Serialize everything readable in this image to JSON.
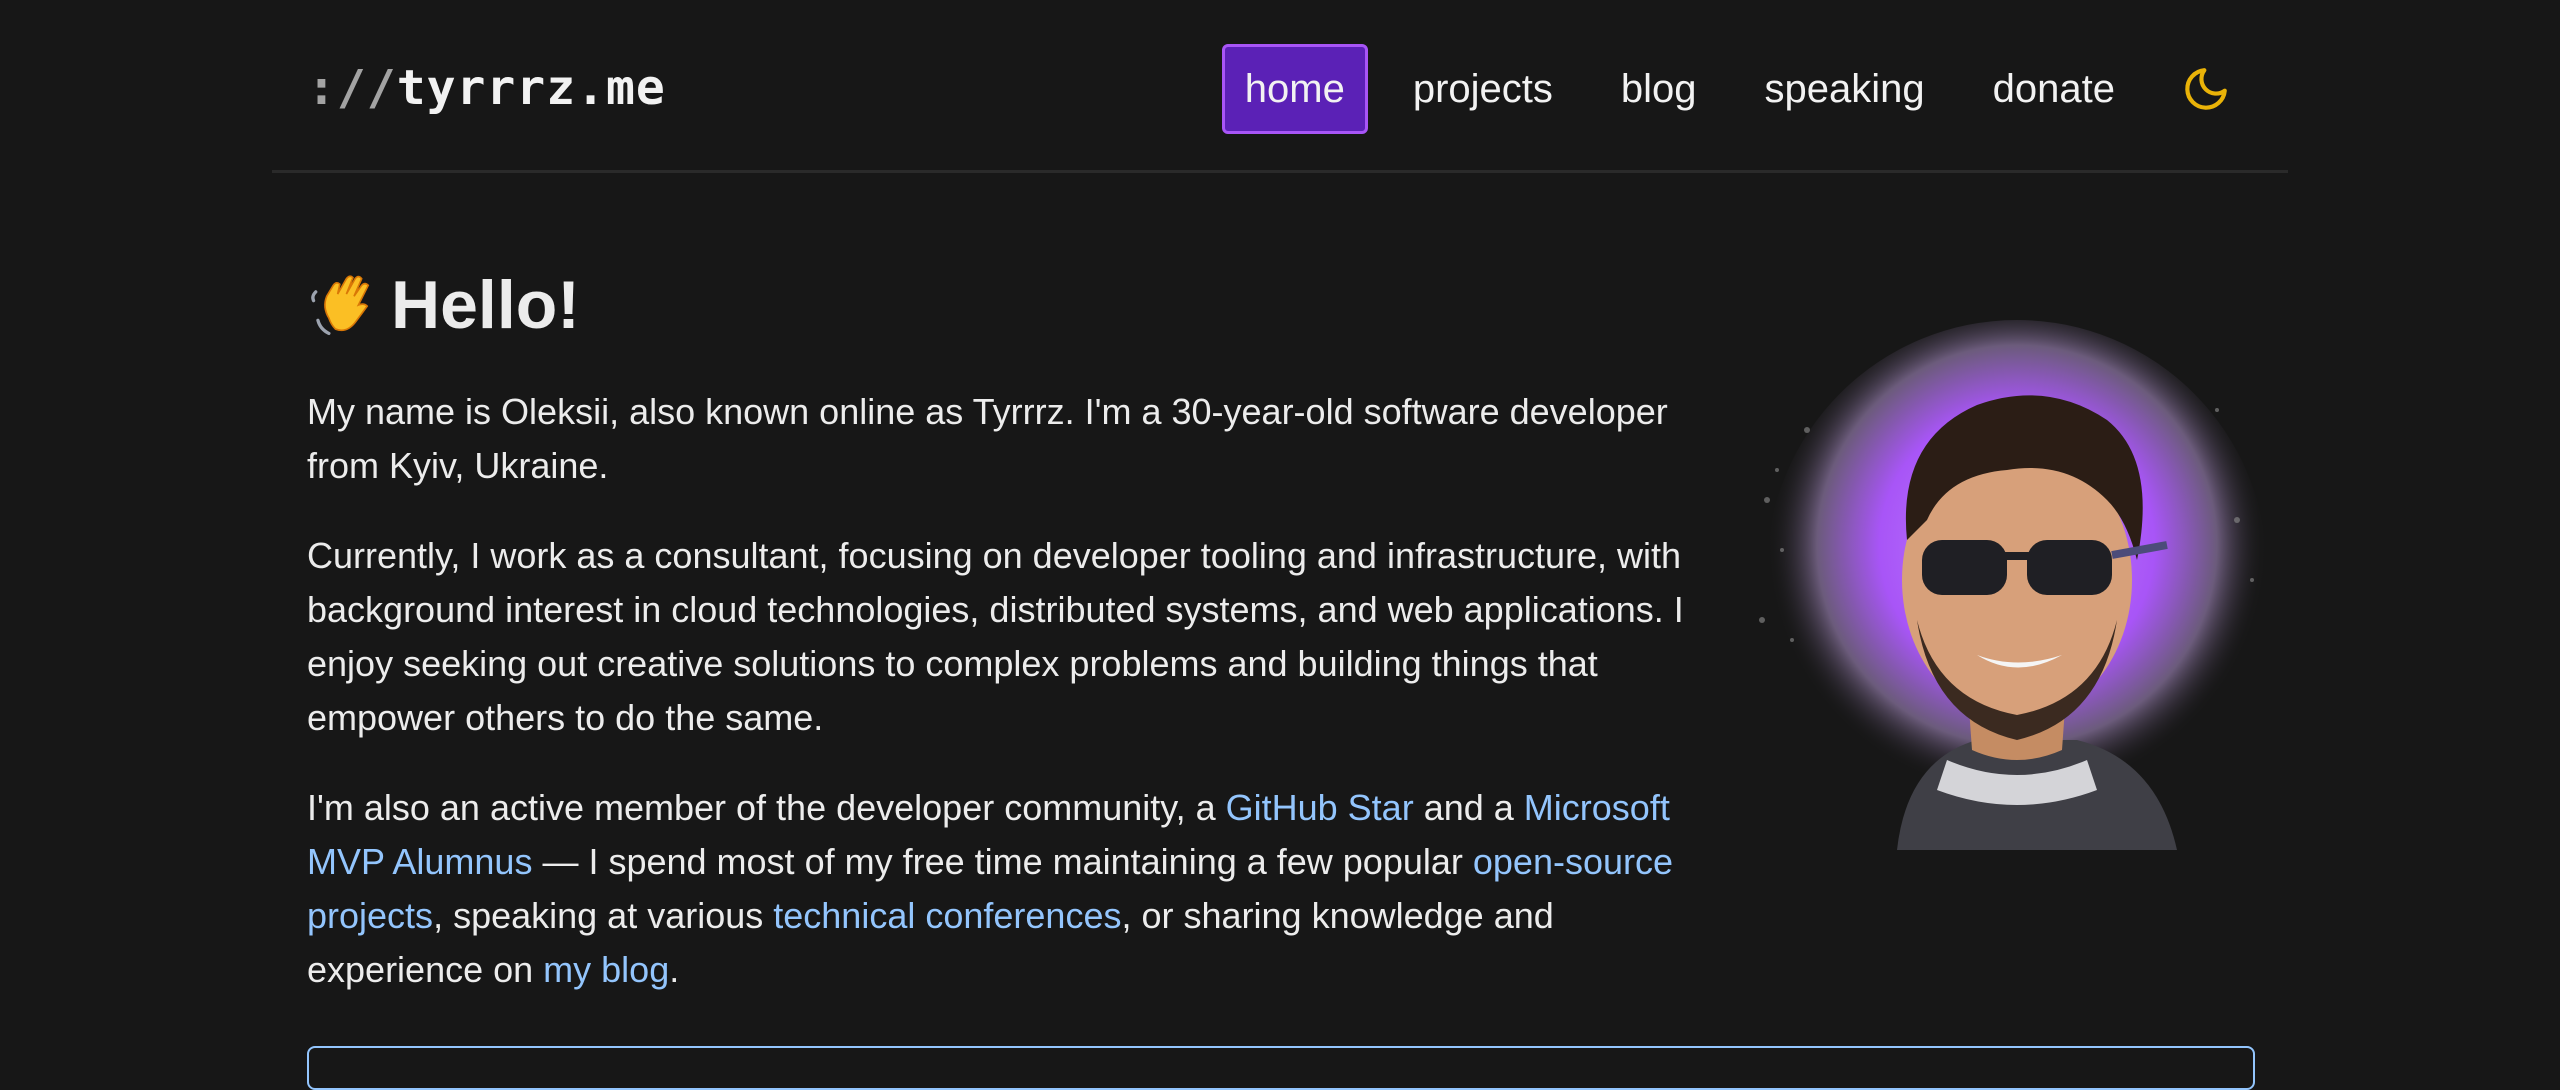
{
  "header": {
    "logo_prefix": "://",
    "logo_name": "tyrrrz.me",
    "nav": [
      "home",
      "projects",
      "blog",
      "speaking",
      "donate"
    ],
    "active_nav": "home",
    "theme_toggle_icon": "moon-icon"
  },
  "hero": {
    "wave_icon": "waving-hand-icon",
    "title": "Hello!",
    "p1": "My name is Oleksii, also known online as Tyrrrz. I'm a 30-year-old software developer from Kyiv, Ukraine.",
    "p2": "Currently, I work as a consultant, focusing on developer tooling and infrastructure, with background interest in cloud technologies, distributed systems, and web applications. I enjoy seeking out creative solutions to complex problems and building things that empower others to do the same.",
    "p3": {
      "t1": "I'm also an active member of the developer community, a ",
      "link_github_star": "GitHub Star",
      "t2": " and a ",
      "link_mvp": "Microsoft MVP Alumnus",
      "t3": " — I spend most of my free time maintaining a few popular ",
      "link_oss": "open-source projects",
      "t4": ", speaking at various ",
      "link_conferences": "technical conferences",
      "t5": ", or sharing knowledge and experience on ",
      "link_blog": "my blog",
      "t6": "."
    },
    "avatar_icon": "avatar-portrait"
  },
  "colors": {
    "background": "#171717",
    "text": "#ececec",
    "link": "#93c5fd",
    "active_nav_bg": "#5b21b6",
    "active_nav_border": "#a855f7",
    "moon": "#eab308"
  }
}
